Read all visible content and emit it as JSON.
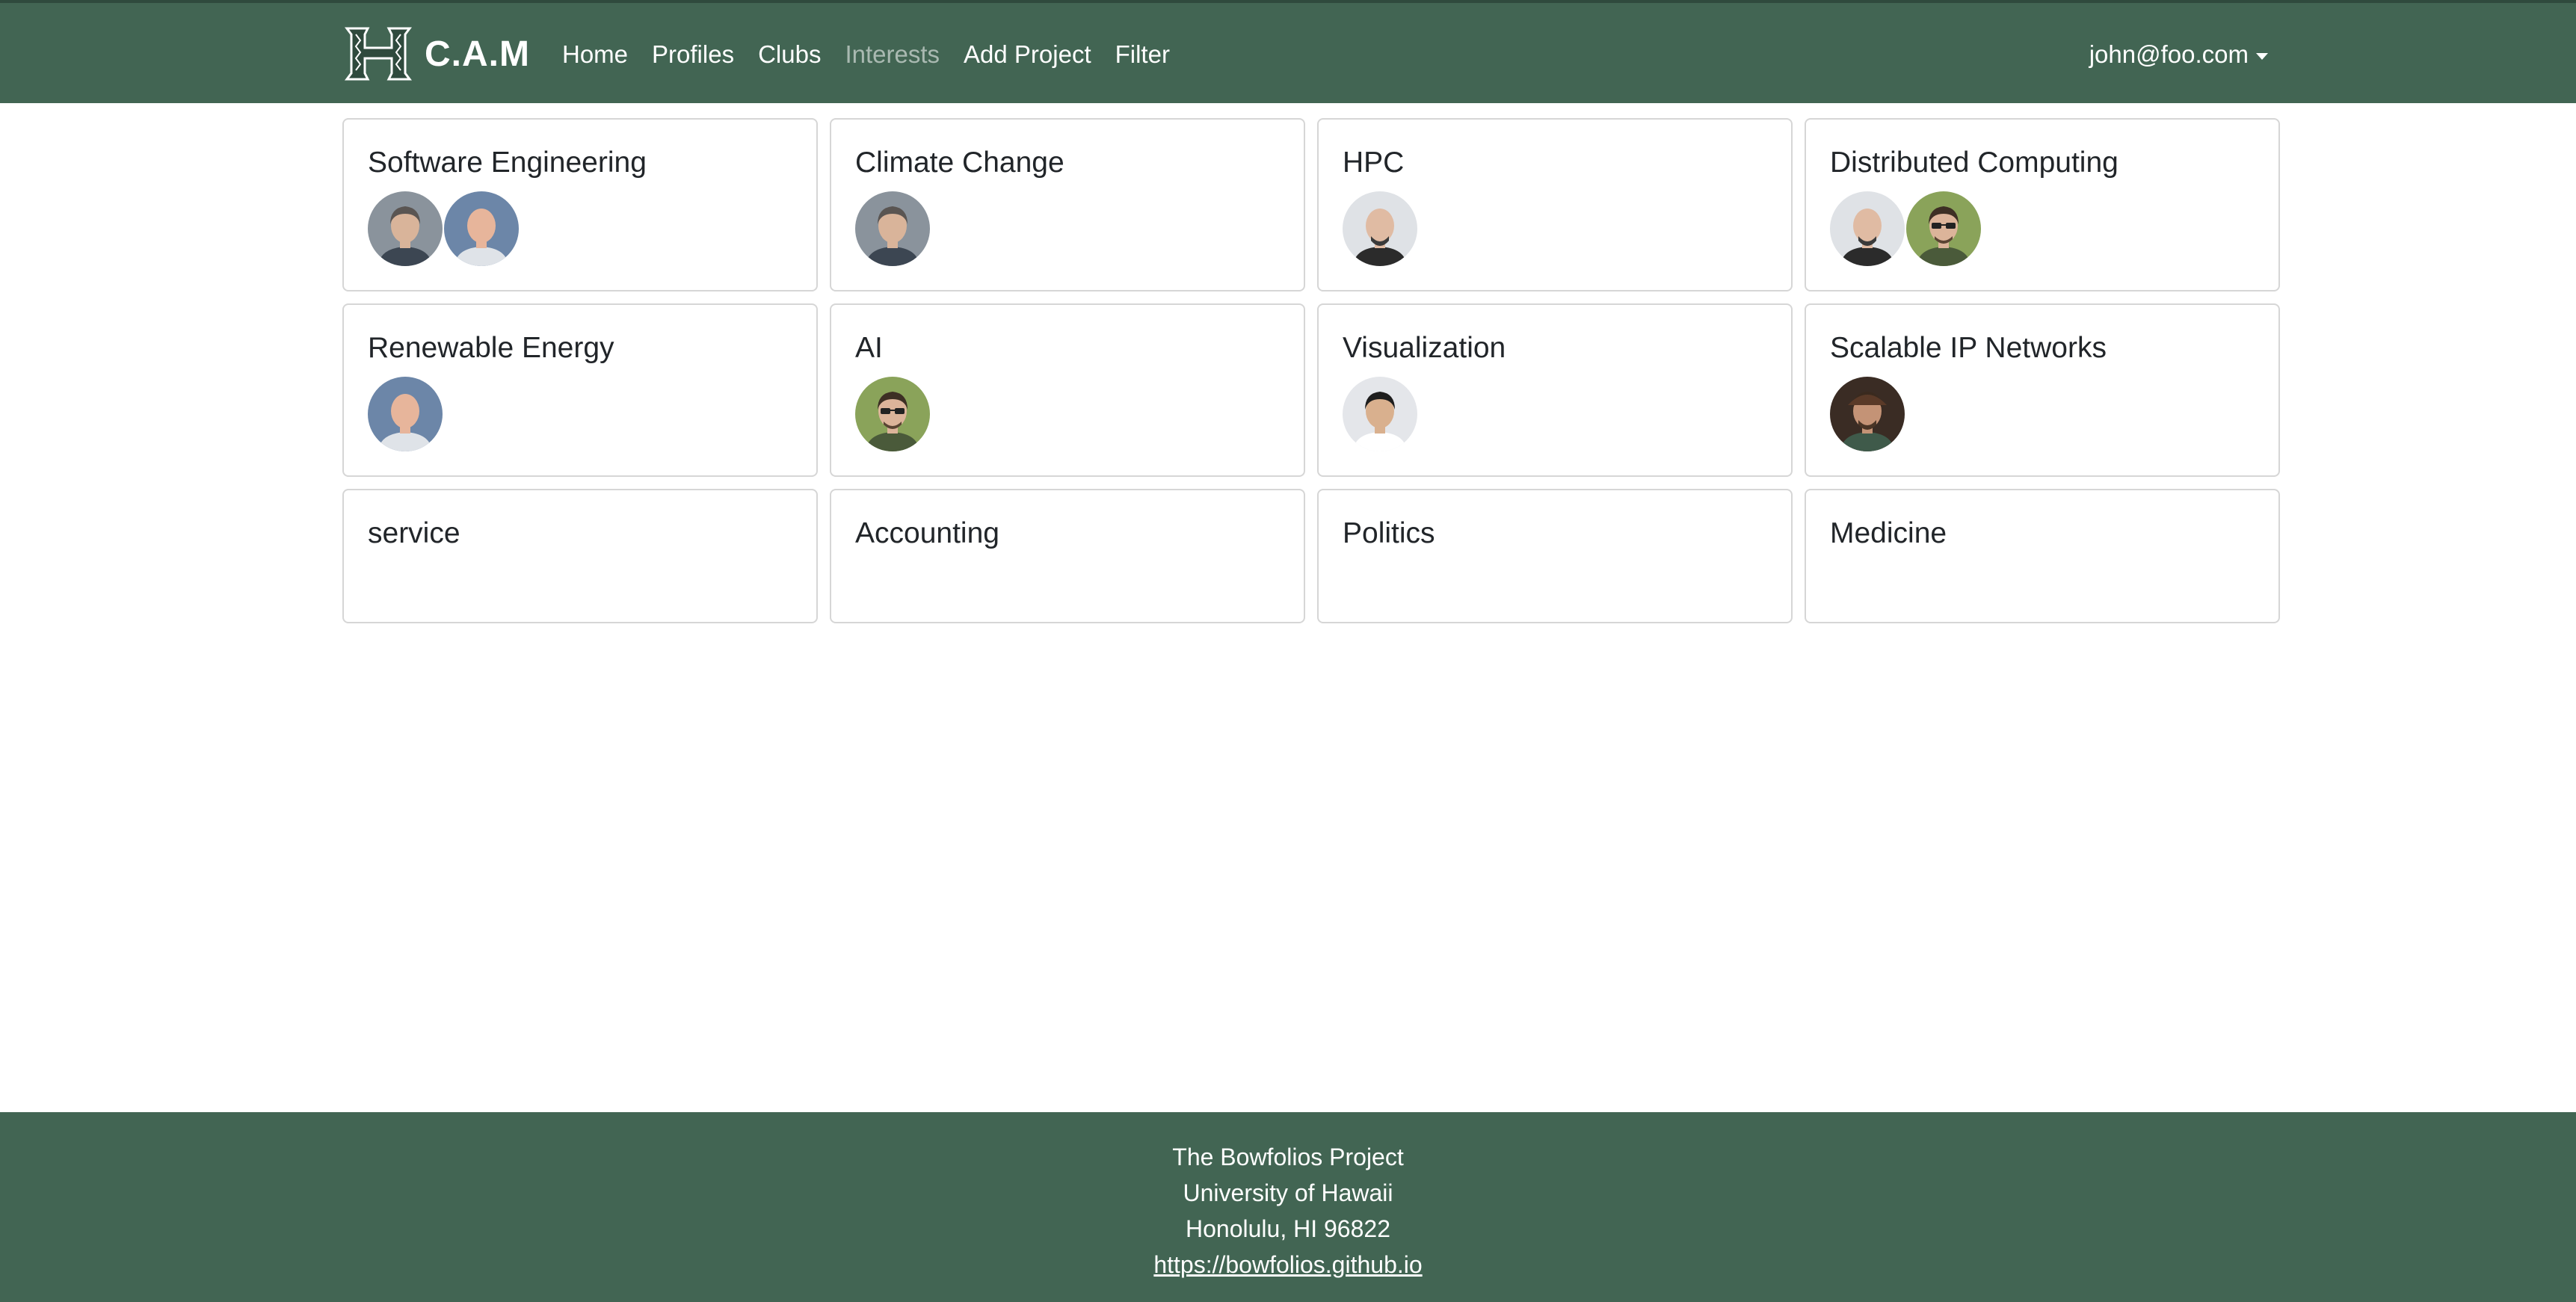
{
  "navbar": {
    "brand": "C.A.M",
    "links": [
      "Home",
      "Profiles",
      "Clubs",
      "Interests",
      "Add Project",
      "Filter"
    ],
    "user": "john@foo.com",
    "bg_color": "#426553"
  },
  "interests": [
    {
      "title": "Software Engineering",
      "members": [
        "gray-curly",
        "bald-smile"
      ]
    },
    {
      "title": "Climate Change",
      "members": [
        "gray-curly"
      ]
    },
    {
      "title": "HPC",
      "members": [
        "bald-beard"
      ]
    },
    {
      "title": "Distributed Computing",
      "members": [
        "bald-beard",
        "glasses-beard"
      ]
    },
    {
      "title": "Renewable Energy",
      "members": [
        "bald-smile"
      ]
    },
    {
      "title": "AI",
      "members": [
        "glasses-beard"
      ]
    },
    {
      "title": "Visualization",
      "members": [
        "short-black"
      ]
    },
    {
      "title": "Scalable IP Networks",
      "members": [
        "hat-beard"
      ]
    },
    {
      "title": "service",
      "members": []
    },
    {
      "title": "Accounting",
      "members": []
    },
    {
      "title": "Politics",
      "members": []
    },
    {
      "title": "Medicine",
      "members": []
    }
  ],
  "footer": {
    "line1": "The Bowfolios Project",
    "line2": "University of Hawaii",
    "line3": "Honolulu, HI 96822",
    "link": "https://bowfolios.github.io"
  }
}
